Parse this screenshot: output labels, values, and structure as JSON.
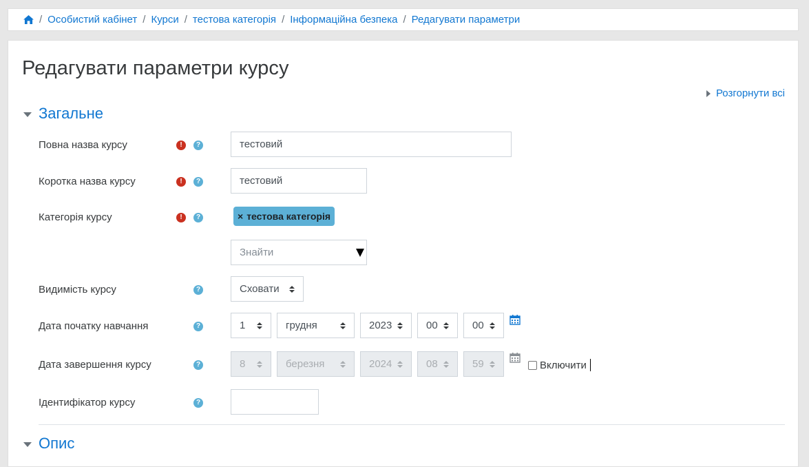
{
  "breadcrumb": {
    "home_icon": "home-icon",
    "items": [
      "Особистий кабінет",
      "Курси",
      "тестова категорія",
      "Інформаційна безпека",
      "Редагувати параметри"
    ]
  },
  "page": {
    "title": "Редагувати параметри курсу",
    "expand_all": "Розгорнути всі"
  },
  "sections": {
    "general": "Загальне",
    "description": "Опис"
  },
  "fields": {
    "fullname": {
      "label": "Повна назва курсу",
      "value": "тестовий"
    },
    "shortname": {
      "label": "Коротка назва курсу",
      "value": "тестовий"
    },
    "category": {
      "label": "Категорія курсу",
      "selected": "тестова категорія",
      "remove": "×",
      "search_placeholder": "Знайти"
    },
    "visibility": {
      "label": "Видимість курсу",
      "value": "Сховати"
    },
    "startdate": {
      "label": "Дата початку навчання",
      "day": "1",
      "month": "грудня",
      "year": "2023",
      "hour": "00",
      "minute": "00"
    },
    "enddate": {
      "label": "Дата завершення курсу",
      "day": "8",
      "month": "березня",
      "year": "2024",
      "hour": "08",
      "minute": "59",
      "enable_label": "Включити",
      "enabled": false
    },
    "idnumber": {
      "label": "Ідентифікатор курсу",
      "value": ""
    }
  },
  "colors": {
    "link": "#1177d1",
    "required": "#ca3120",
    "help": "#5cb0d6",
    "badge": "#5cb0d6"
  },
  "icons": {
    "required": "exclamation-circle-icon",
    "help": "question-circle-icon",
    "calendar": "calendar-icon",
    "expand": "caret-right-icon",
    "collapse": "caret-down-icon"
  }
}
